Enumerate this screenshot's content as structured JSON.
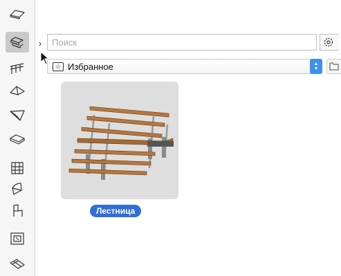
{
  "search": {
    "placeholder": "Поиск",
    "value": ""
  },
  "folder": {
    "selected": "Избранное",
    "icon": "star-folder-icon"
  },
  "tools": [
    "slab-tool",
    "stair-tool",
    "railing-tool",
    "roof-tool",
    "shell-tool",
    "mesh-tool",
    "curtain-wall-tool",
    "morph-tool",
    "object-tool",
    "zone-tool",
    "beam-tool"
  ],
  "selected_tool": "stair-tool",
  "library": {
    "items": [
      {
        "label": "Лестница",
        "icon": "stair-object-icon"
      }
    ]
  },
  "colors": {
    "selection": "#2f6fd6",
    "thumb_bg": "#dedede",
    "stepper": "#3d8ff0"
  }
}
